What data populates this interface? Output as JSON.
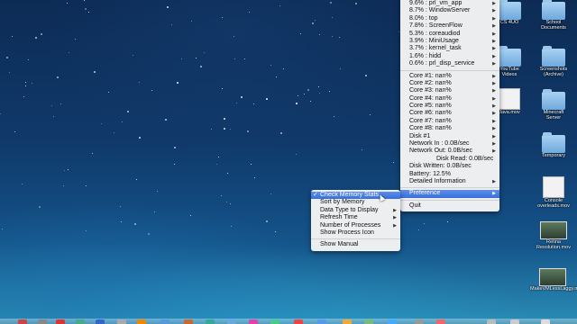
{
  "main_menu": {
    "process_items": [
      "9.6% : prl_vm_app",
      "8.7% : WindowServer",
      "8.0% : top",
      "7.8% : ScreenFlow",
      "5.3% : coreaudiod",
      "3.9% : MiniUsage",
      "3.7% : kernel_task",
      "1.6% : hidd",
      "0.6% : prl_disp_service"
    ],
    "stat_items": [
      "Core #1: nan%",
      "Core #2: nan%",
      "Core #3: nan%",
      "Core #4: nan%",
      "Core #5: nan%",
      "Core #6: nan%",
      "Core #7: nan%",
      "Core #8: nan%",
      "Disk #1",
      "Network In  : 0.0B/sec",
      "Network Out: 0.0B/sec",
      "Disk Read: 0.0B/sec",
      "Disk Written: 0.0B/sec",
      "Battery: 12.5%",
      "Detailed Information"
    ],
    "preference_label": "Preference",
    "quit_label": "Quit"
  },
  "preference_submenu": {
    "check_mark": "✓",
    "items": [
      "Check Memory Stats",
      "Sort by Memory",
      "Data Type to Display",
      "Refresh Time",
      "Number of Processes",
      "Show Process Icon"
    ],
    "manual_label": "Show Manual"
  },
  "desktop_icons": [
    {
      "label": "CS 4UO",
      "kind": "folder"
    },
    {
      "label": "School Documents",
      "kind": "folder"
    },
    {
      "label": "YouTube Videos",
      "kind": "folder"
    },
    {
      "label": "Screenshots (Archive)",
      "kind": "folder"
    },
    {
      "label": "Java.mov",
      "kind": "doc"
    },
    {
      "label": "Minecraft Server",
      "kind": "folder"
    },
    {
      "label": "Temporary",
      "kind": "folder"
    },
    {
      "label": "Console overleads.mov",
      "kind": "doc"
    },
    {
      "label": "Retina Resolution.mov",
      "kind": "thumb"
    },
    {
      "label": "MakeVMLessLaggy.mov",
      "kind": "thumb"
    }
  ],
  "colors": {
    "highlight": "#3a6fd8",
    "menu_bg": "#f4f4f4"
  }
}
